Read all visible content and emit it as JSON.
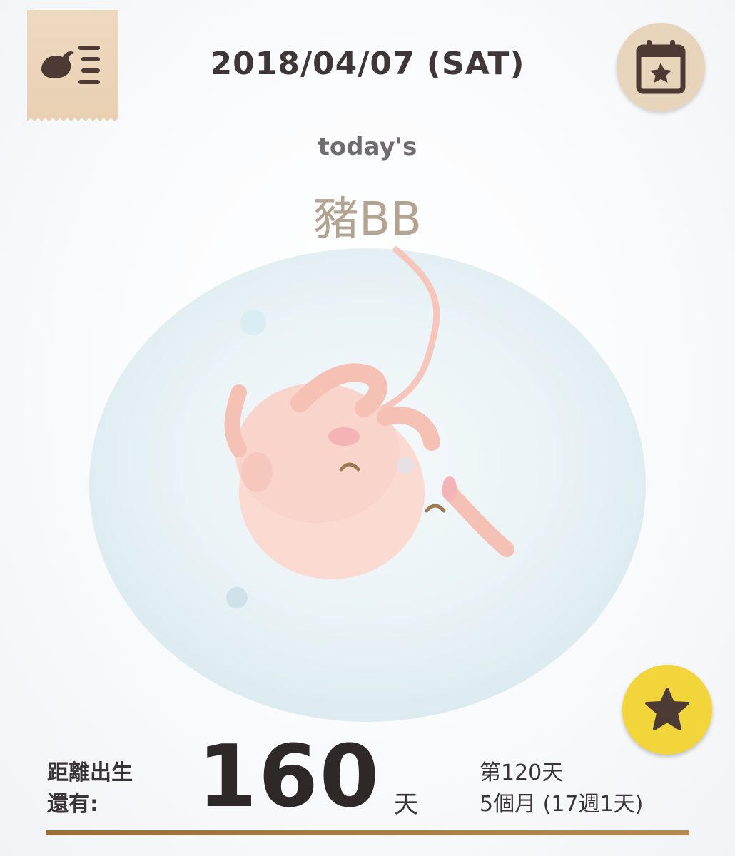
{
  "header": {
    "date": "2018/04/07 (SAT)",
    "menu_icon": "bird-list-icon",
    "calendar_icon": "calendar-star-icon"
  },
  "main": {
    "todays_label": "today's",
    "baby_name": "豬BB",
    "illustration": "fetus-in-womb-illustration"
  },
  "favorite": {
    "icon": "star-icon",
    "color": "#f2d53a"
  },
  "countdown": {
    "label_line1": "距離出生",
    "label_line2": "還有:",
    "days_left": "160",
    "unit": "天"
  },
  "pregnancy": {
    "day_text": "第120天",
    "duration_text": "5個月 (17週1天)"
  },
  "progress": {
    "fraction": 1.0,
    "color": "#9c6e36"
  }
}
